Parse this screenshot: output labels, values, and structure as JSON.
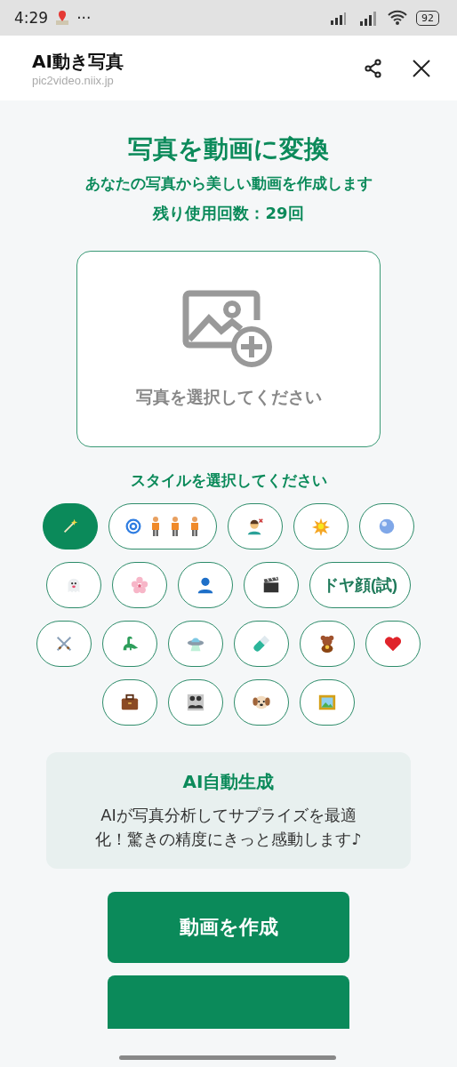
{
  "status_bar": {
    "time": "4:29",
    "more": "···",
    "battery": "92"
  },
  "header": {
    "title": "AI動き写真",
    "url": "pic2video.niix.jp"
  },
  "hero": {
    "title": "写真を動画に変換",
    "subtitle": "あなたの写真から美しい動画を作成します",
    "remaining": "残り使用回数：29回"
  },
  "upload": {
    "label": "写真を選択してください"
  },
  "styles": {
    "heading": "スタイルを選択してください",
    "rows": [
      [
        {
          "kind": "icon",
          "selected": true
        },
        {
          "kind": "wide-icon",
          "selected": false
        },
        {
          "kind": "icon",
          "selected": false
        },
        {
          "kind": "icon",
          "selected": false
        },
        {
          "kind": "icon",
          "selected": false
        }
      ],
      [
        {
          "kind": "icon",
          "selected": false
        },
        {
          "kind": "icon",
          "selected": false
        },
        {
          "kind": "icon",
          "selected": false
        },
        {
          "kind": "icon",
          "selected": false
        },
        {
          "kind": "text",
          "label": "ドヤ顔(試)",
          "selected": false
        }
      ],
      [
        {
          "kind": "icon",
          "selected": false
        },
        {
          "kind": "icon",
          "selected": false
        },
        {
          "kind": "icon",
          "selected": false
        },
        {
          "kind": "icon",
          "selected": false
        },
        {
          "kind": "icon",
          "selected": false
        },
        {
          "kind": "icon",
          "selected": false
        }
      ],
      [
        {
          "kind": "icon",
          "selected": false
        },
        {
          "kind": "icon",
          "selected": false
        },
        {
          "kind": "icon",
          "selected": false
        },
        {
          "kind": "icon",
          "selected": false
        }
      ]
    ]
  },
  "info": {
    "title": "AI自動生成",
    "body": "AIが写真分析してサプライズを最適化！驚きの精度にきっと感動します♪"
  },
  "buttons": [
    "動画を作成"
  ],
  "partial_button": true
}
